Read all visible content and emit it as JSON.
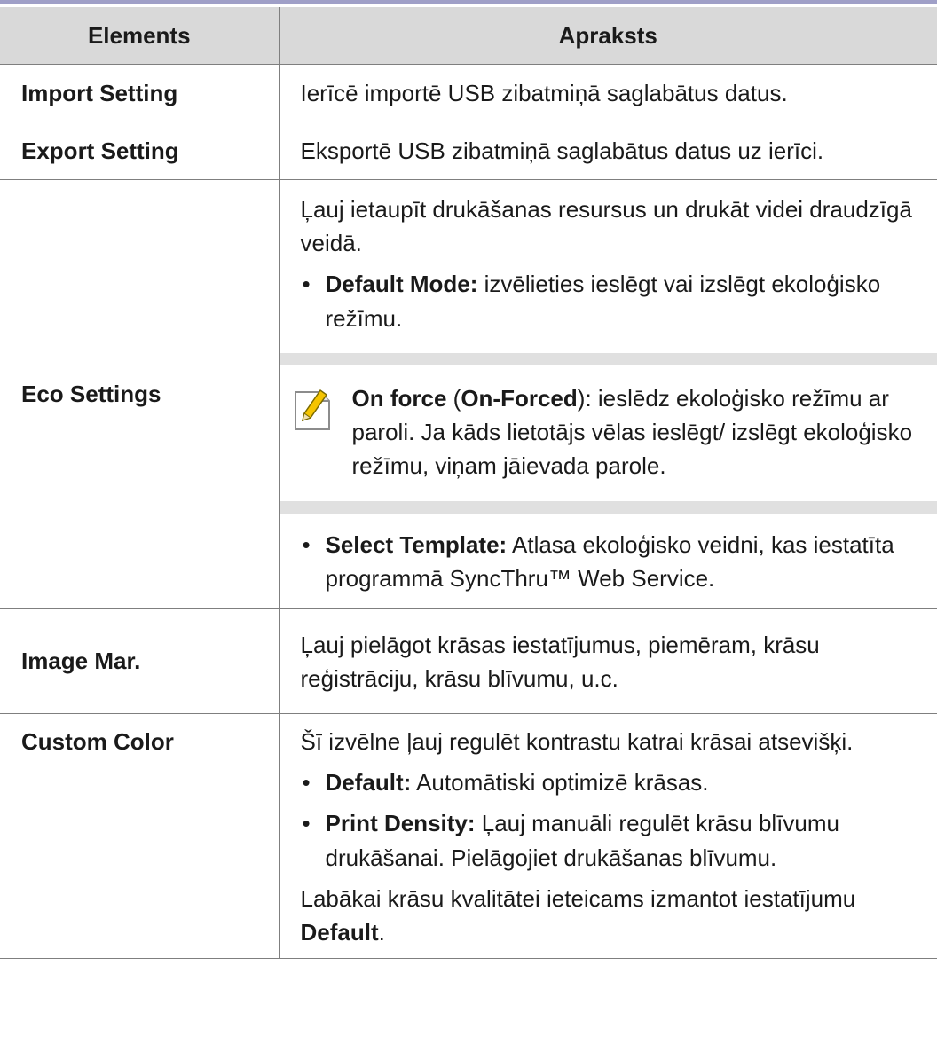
{
  "table": {
    "headers": {
      "element": "Elements",
      "description": "Apraksts"
    },
    "rows": [
      {
        "element": "Import Setting",
        "text": "Ierīcē importē USB zibatmiņā saglabātus datus."
      },
      {
        "element": "Export Setting",
        "text": "Eksportē USB zibatmiņā saglabātus datus uz ierīci."
      },
      {
        "element": "Eco Settings",
        "intro": "Ļauj ietaupīt drukāšanas resursus un drukāt videi draudzīgā veidā.",
        "bullet1_label": "Default Mode:",
        "bullet1_text": "izvēlieties ieslēgt vai izslēgt ekoloģisko režīmu.",
        "note": {
          "icon": "note-pencil-icon",
          "label1": "On force",
          "paren_open": "(",
          "label2": "On-Forced",
          "text": "): ieslēdz ekoloģisko režīmu ar paroli. Ja kāds lietotājs vēlas ieslēgt/ izslēgt ekoloģisko režīmu, viņam jāievada parole."
        },
        "bullet2_label": "Select Template:",
        "bullet2_text": "Atlasa ekoloģisko veidni, kas iestatīta programmā SyncThru™ Web Service."
      },
      {
        "element": "Image Mar.",
        "text": "Ļauj pielāgot krāsas iestatījumus, piemēram, krāsu reģistrāciju, krāsu blīvumu, u.c."
      },
      {
        "element": "Custom Color",
        "intro": "Šī izvēlne ļauj regulēt kontrastu katrai krāsai atsevišķi.",
        "bullet1_label": "Default:",
        "bullet1_text": "Automātiski optimizē krāsas.",
        "bullet2_label": "Print Density:",
        "bullet2_text": "Ļauj manuāli regulēt krāsu blīvumu drukāšanai. Pielāgojiet drukāšanas blīvumu.",
        "outro_text": "Labākai krāsu kvalitātei ieteicams izmantot iestatījumu",
        "outro_bold": "Default",
        "outro_end": "."
      }
    ]
  },
  "bullet_char": "•"
}
